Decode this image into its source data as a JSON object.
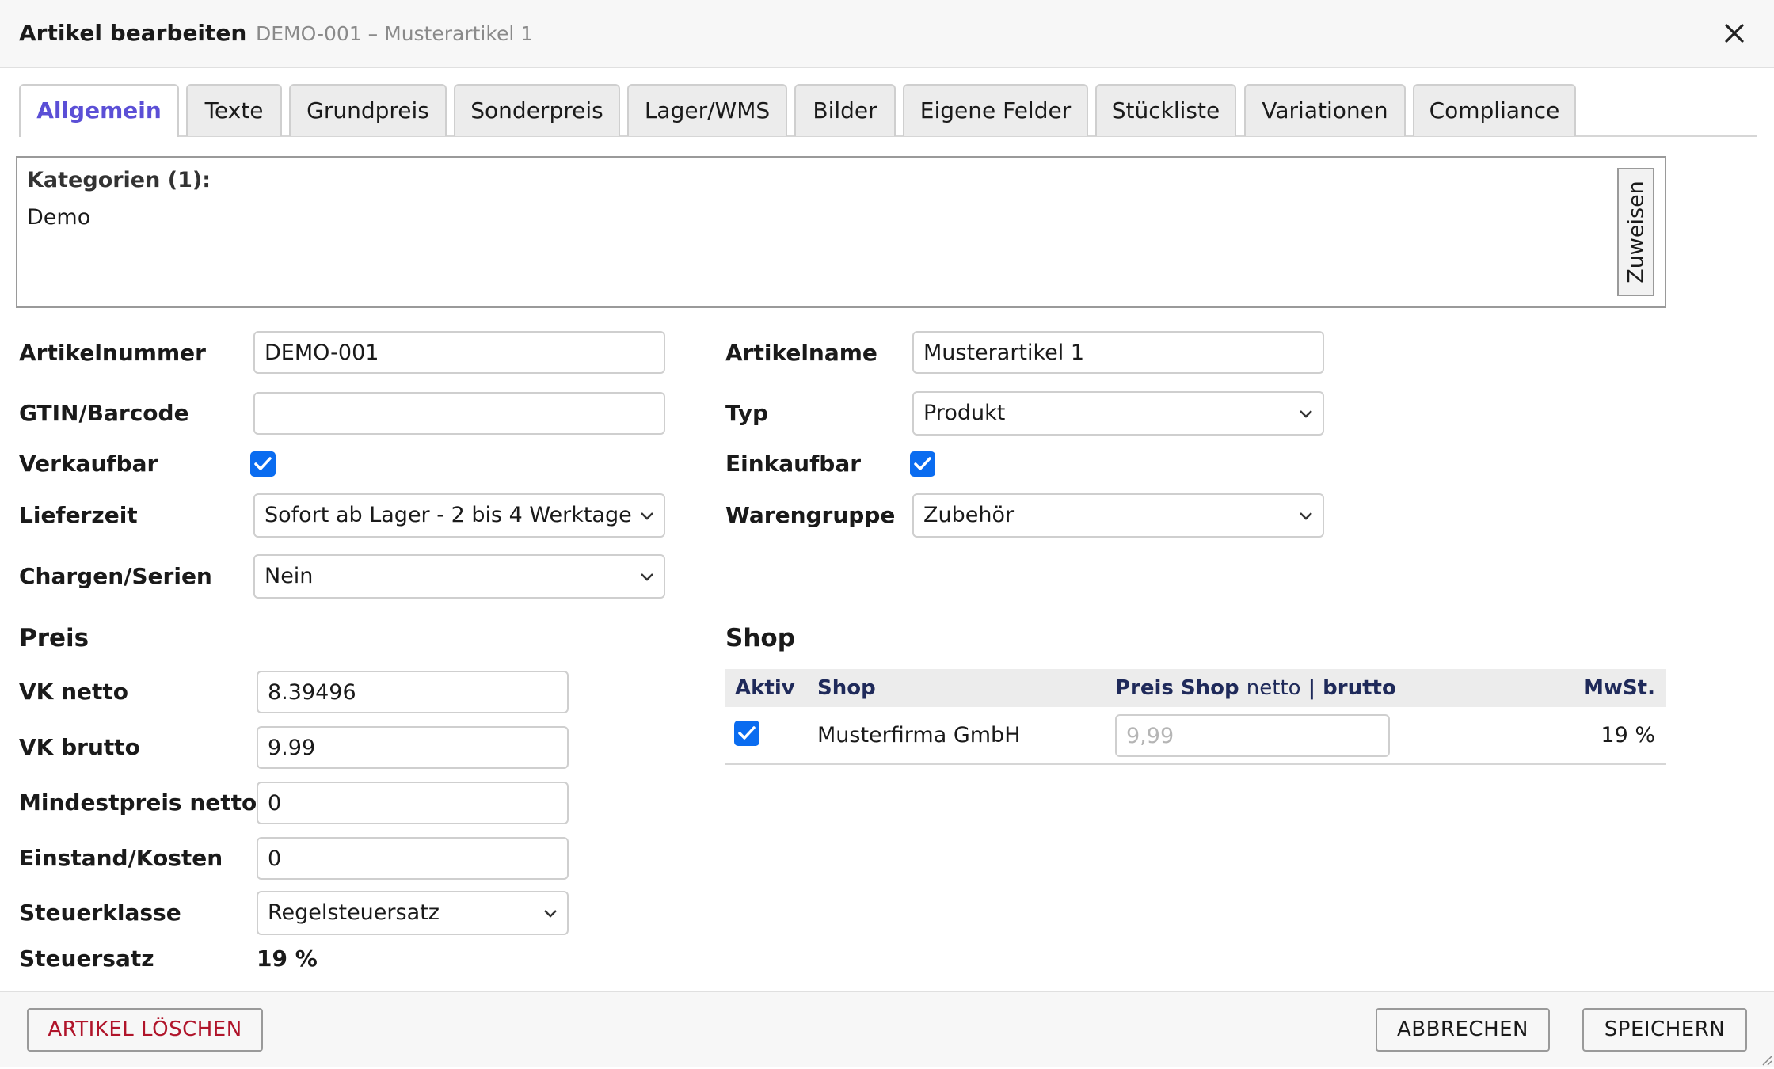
{
  "header": {
    "title": "Artikel bearbeiten",
    "subtitle": "DEMO-001 – Musterartikel 1"
  },
  "tabs": [
    {
      "label": "Allgemein",
      "active": true
    },
    {
      "label": "Texte"
    },
    {
      "label": "Grundpreis"
    },
    {
      "label": "Sonderpreis"
    },
    {
      "label": "Lager/WMS"
    },
    {
      "label": "Bilder"
    },
    {
      "label": "Eigene Felder"
    },
    {
      "label": "Stückliste"
    },
    {
      "label": "Variationen"
    },
    {
      "label": "Compliance"
    }
  ],
  "categories": {
    "label": "Kategorien (1):",
    "value": "Demo",
    "assign_button": "Zuweisen"
  },
  "form": {
    "artikelnummer_label": "Artikelnummer",
    "artikelnummer_value": "DEMO-001",
    "artikelname_label": "Artikelname",
    "artikelname_value": "Musterartikel 1",
    "gtin_label": "GTIN/Barcode",
    "gtin_value": "",
    "typ_label": "Typ",
    "typ_value": "Produkt",
    "verkaufbar_label": "Verkaufbar",
    "verkaufbar_checked": true,
    "einkaufbar_label": "Einkaufbar",
    "einkaufbar_checked": true,
    "lieferzeit_label": "Lieferzeit",
    "lieferzeit_value": "Sofort ab Lager - 2 bis 4 Werktage",
    "warengruppe_label": "Warengruppe",
    "warengruppe_value": "Zubehör",
    "chargen_label": "Chargen/Serien",
    "chargen_value": "Nein"
  },
  "preis": {
    "heading": "Preis",
    "vk_netto_label": "VK netto",
    "vk_netto_value": "8.39496",
    "vk_brutto_label": "VK brutto",
    "vk_brutto_value": "9.99",
    "mindestpreis_label": "Mindestpreis netto",
    "mindestpreis_value": "0",
    "einstand_label": "Einstand/Kosten",
    "einstand_value": "0",
    "steuerklasse_label": "Steuerklasse",
    "steuerklasse_value": "Regelsteuersatz",
    "steuersatz_label": "Steuersatz",
    "steuersatz_value": "19 %"
  },
  "shop": {
    "heading": "Shop",
    "columns": {
      "aktiv": "Aktiv",
      "shop": "Shop",
      "preis_bold": "Preis Shop",
      "preis_netto": "netto",
      "preis_sep": "|",
      "preis_brutto": "brutto",
      "mwst": "MwSt."
    },
    "rows": [
      {
        "aktiv": true,
        "shop": "Musterfirma GmbH",
        "price_placeholder": "9,99",
        "mwst": "19 %"
      }
    ]
  },
  "footer": {
    "delete_label": "ARTIKEL LÖSCHEN",
    "cancel_label": "ABBRECHEN",
    "save_label": "SPEICHERN"
  },
  "colors": {
    "accent": "#5b4fd6",
    "checkbox": "#0a6cf0",
    "danger": "#b0142a",
    "table_header_text": "#1f2a5a"
  }
}
